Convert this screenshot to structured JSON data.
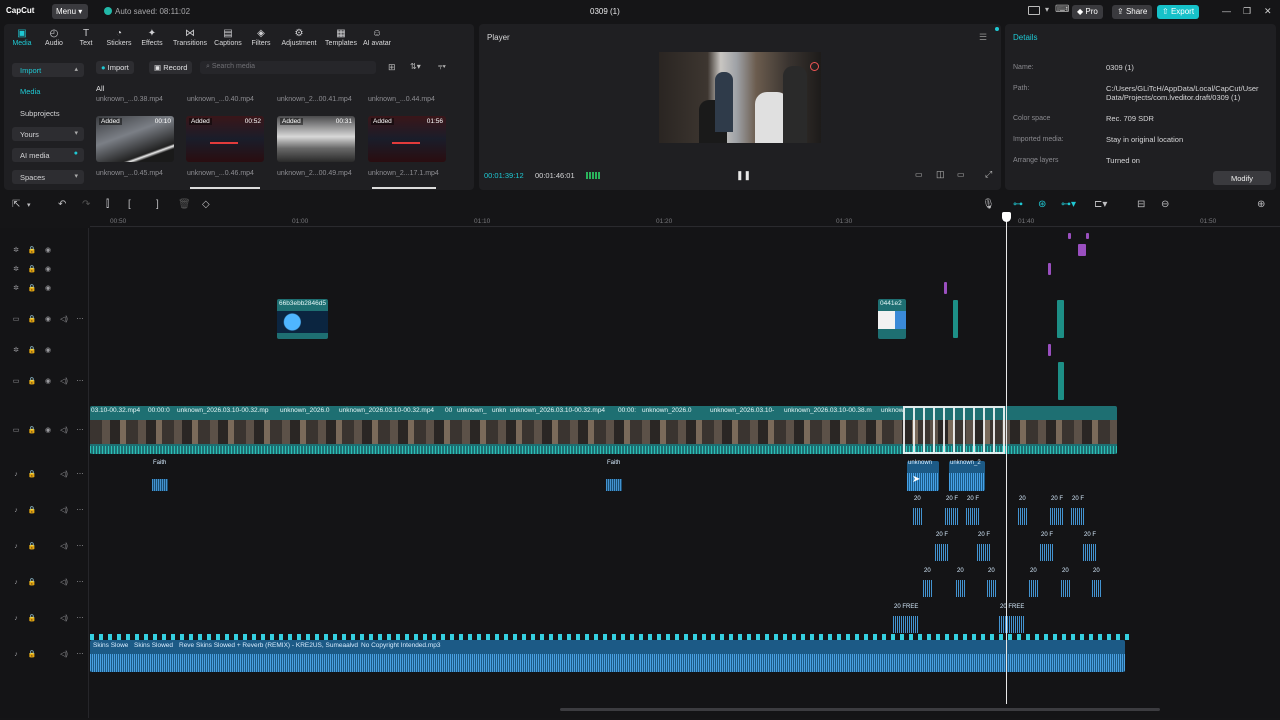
{
  "app": {
    "logo": "CapCut",
    "menu_label": "Menu",
    "autosave_text": "Auto saved: 08:11:02",
    "title": "0309 (1)",
    "pro_label": "Pro",
    "share_label": "Share",
    "export_label": "Export"
  },
  "toolbar": {
    "items": [
      {
        "label": "Media",
        "icon": "media-icon"
      },
      {
        "label": "Audio",
        "icon": "audio-icon"
      },
      {
        "label": "Text",
        "icon": "text-icon"
      },
      {
        "label": "Stickers",
        "icon": "stickers-icon"
      },
      {
        "label": "Effects",
        "icon": "effects-icon"
      },
      {
        "label": "Transitions",
        "icon": "transitions-icon"
      },
      {
        "label": "Captions",
        "icon": "captions-icon"
      },
      {
        "label": "Filters",
        "icon": "filters-icon"
      },
      {
        "label": "Adjustment",
        "icon": "adjustment-icon"
      },
      {
        "label": "Templates",
        "icon": "templates-icon"
      },
      {
        "label": "AI avatar",
        "icon": "ai-avatar-icon"
      }
    ]
  },
  "sidebar": {
    "items": [
      {
        "label": "Import"
      },
      {
        "label": "Media"
      },
      {
        "label": "Subprojects"
      },
      {
        "label": "Yours"
      },
      {
        "label": "AI media"
      },
      {
        "label": "Spaces"
      }
    ]
  },
  "media": {
    "import_label": "Import",
    "record_label": "Record",
    "search_placeholder": "Search media",
    "filter_all": "All",
    "top_names": [
      "unknown_...0.38.mp4",
      "unknown_...0.40.mp4",
      "unknown_2...00.41.mp4",
      "unknown_...0.44.mp4"
    ],
    "thumbs": [
      {
        "added": "Added",
        "dur": "00:10",
        "name": "unknown_...0.45.mp4"
      },
      {
        "added": "Added",
        "dur": "00:52",
        "name": "unknown_...0.46.mp4"
      },
      {
        "added": "Added",
        "dur": "00:31",
        "name": "unknown_2...00.49.mp4"
      },
      {
        "added": "Added",
        "dur": "01:56",
        "name": "unknown_2...17.1.mp4"
      }
    ]
  },
  "player": {
    "title": "Player",
    "current_time": "00:01:39:12",
    "total_time": "00:01:46:01"
  },
  "details": {
    "title": "Details",
    "fields": [
      {
        "label": "Name:",
        "value": "0309 (1)"
      },
      {
        "label": "Path:",
        "value": "C:/Users/GLiTcH/AppData/Local/CapCut/User Data/Projects/com.lveditor.draft/0309 (1)"
      },
      {
        "label": "Color space",
        "value": "Rec. 709 SDR"
      },
      {
        "label": "Imported media:",
        "value": "Stay in original location"
      },
      {
        "label": "Arrange layers",
        "value": "Turned on"
      }
    ],
    "modify_label": "Modify"
  },
  "timeline": {
    "ruler": [
      "00:50",
      "01:00",
      "01:10",
      "01:20",
      "01:30",
      "01:40",
      "01:50"
    ],
    "main_clip_labels": [
      "03.10-00.32.mp4",
      "00:00:0",
      "unknown_2026.03.10-00.32.mp",
      "unknown_2026.03.10-00.32.mp4",
      "unknown_2026.0",
      "unknown_2026.03.10-00.32.mp4",
      "00",
      "unknown_",
      "unkn",
      "unknown_2026.03.10-00.32.mp4",
      "00:00:",
      "unknown_2026.0",
      "unknown_2026.03.10-",
      "unknown_2026.03.10-00.38.m",
      "unknown"
    ],
    "overlay_clip_1": "66b3ebb2846d5",
    "overlay_clip_2": "0441e2",
    "audio_faith": "Faith",
    "audio_unknown_1": "unknown",
    "audio_unknown_2": "unknown_2",
    "sfx_20": "20",
    "sfx_20f": "20 F",
    "sfx_20free": "20 FREE",
    "music_labels": [
      "Skins Slowe",
      "Skins Slowed",
      "Reve",
      "Skins Slowed + Reverb (REMIX) - KRE2US, Sumeaalvd",
      "No Copyright Intended.mp3"
    ]
  },
  "colors": {
    "accent": "#1fc8d3",
    "video_clip": "#1e6f72",
    "audio_clip": "#1c5a86",
    "marker_purple": "#9a4fbf",
    "marker_teal": "#1d8f86"
  }
}
